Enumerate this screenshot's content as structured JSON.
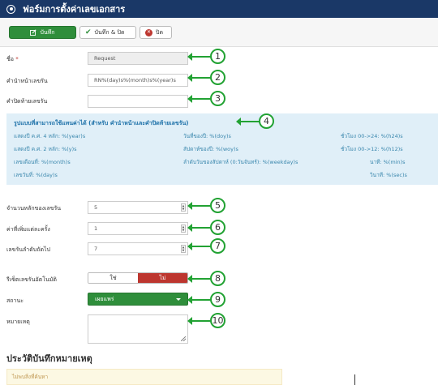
{
  "title": "ฟอร์มการตั้งค่าเลขเอกสาร",
  "toolbar": {
    "save_label": "บันทึก",
    "save_close_label": "บันทึก & ปิด",
    "close_label": "ปิด"
  },
  "fields": {
    "name_label": "ชื่อ",
    "name_required": "*",
    "name_value": "Request",
    "prefix_label": "คำนำหน้าเลขรัน",
    "prefix_value": "RN%(day)s%(month)s%(year)s",
    "suffix_label": "คำปิดท้ายเลขรัน",
    "suffix_value": "",
    "padding_label": "จำนวนหลักของเลขรัน",
    "padding_value": "5",
    "increment_label": "ค่าที่เพิ่มแต่ละครั้ง",
    "increment_value": "1",
    "next_label": "เลขรันลำดับถัดไป",
    "next_value": "7",
    "reset_label": "รีเซ็ตเลขรันอัตโนมัติ",
    "reset_yes": "ใช่",
    "reset_no": "ไม่",
    "reset_selected": "ไม่",
    "status_label": "สถานะ",
    "status_value": "เผยแพร่",
    "note_label": "หมายเหตุ",
    "note_value": ""
  },
  "variables": {
    "title": "รูปแบบที่สามารถใช้แทนค่าได้ (สำหรับ คำนำหน้าและคำปิดท้ายเลขรัน)",
    "col1": [
      "แสดงปี ค.ศ. 4 หลัก: %(year)s",
      "แสดงปี ค.ศ. 2 หลัก: %(y)s",
      "เลขเดือนที่: %(month)s",
      "เลขวันที่: %(day)s"
    ],
    "col2": [
      "วันที่ของปี: %(doy)s",
      "สัปดาห์ของปี: %(woy)s",
      "ลำดับวันของสัปดาห์ (0:วันจันทร์): %(weekday)s"
    ],
    "col3": [
      "ชั่วโมง 00->24: %(h24)s",
      "ชั่วโมง 00->12: %(h12)s",
      "นาที: %(min)s",
      "วินาที: %(sec)s"
    ]
  },
  "callouts": [
    "1",
    "2",
    "3",
    "4",
    "5",
    "6",
    "7",
    "8",
    "9",
    "10"
  ],
  "history": {
    "title": "ประวัติบันทึกหมายเหตุ",
    "empty_text": "ไม่พบสิ่งที่ค้นหา"
  },
  "colors": {
    "header_bg": "#1a3867",
    "save_green": "#2f8e3b",
    "danger_red": "#bd362f",
    "callout_green": "#22a233",
    "info_bg": "#e0eff8",
    "info_text": "#3a87ad"
  },
  "icons": {
    "title": "dot-circle-icon",
    "save": "edit-icon",
    "save_close": "check-icon",
    "close": "times-circle-icon",
    "status_dropdown": "caret-down-icon"
  }
}
